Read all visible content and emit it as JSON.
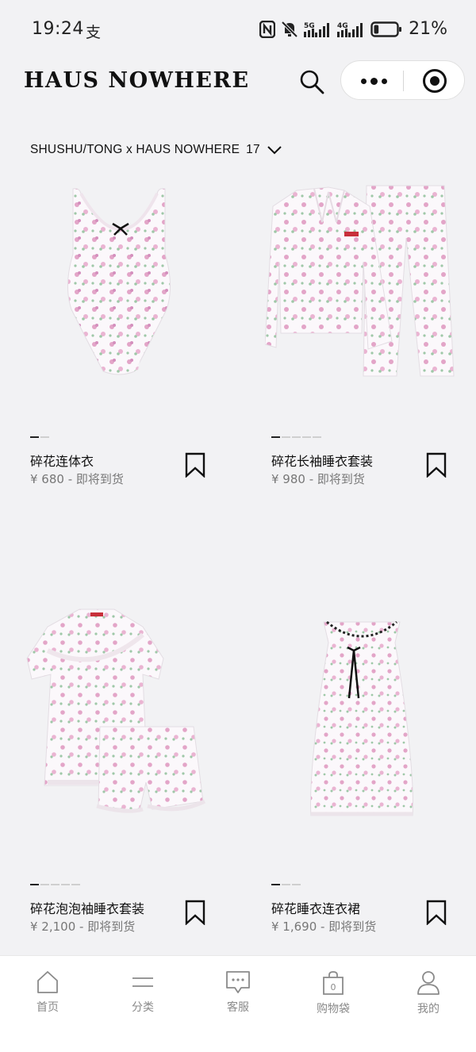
{
  "status_bar": {
    "time": "19:24",
    "app_glyph": "支",
    "icons": [
      "nfc-icon",
      "mute-icon",
      "signal-5g-icon",
      "signal-4g-icon",
      "battery-icon"
    ],
    "net1": "5G",
    "net2": "4G",
    "battery": "21%",
    "battery_level": 0.21
  },
  "header": {
    "brand": "HAUS NOWHERE",
    "search_icon": "search-icon",
    "more_icon": "more-dots-icon",
    "close_icon": "target-close-icon"
  },
  "collection": {
    "name": "SHUSHU/TONG x HAUS NOWHERE",
    "count": "17",
    "chevron_icon": "chevron-down-icon"
  },
  "products": [
    {
      "name": "碎花连体衣",
      "price": "¥ 680 - 即将到货",
      "dots": 2,
      "active_dot": 0,
      "image": "floral-bodysuit"
    },
    {
      "name": "碎花长袖睡衣套装",
      "price": "¥ 980 - 即将到货",
      "dots": 5,
      "active_dot": 0,
      "image": "floral-long-sleeve-pajama-set"
    },
    {
      "name": "碎花泡泡袖睡衣套装",
      "price": "¥ 2,100 - 即将到货",
      "dots": 5,
      "active_dot": 0,
      "image": "floral-puff-sleeve-pajama-set"
    },
    {
      "name": "碎花睡衣连衣裙",
      "price": "¥ 1,690 - 即将到货",
      "dots": 3,
      "active_dot": 0,
      "image": "floral-nightdress"
    }
  ],
  "tabbar": {
    "items": [
      {
        "label": "首页",
        "icon": "home-icon"
      },
      {
        "label": "分类",
        "icon": "menu-icon"
      },
      {
        "label": "客服",
        "icon": "chat-icon"
      },
      {
        "label": "购物袋",
        "icon": "shopping-bag-icon",
        "badge": "0"
      },
      {
        "label": "我的",
        "icon": "profile-icon"
      }
    ]
  },
  "colors": {
    "background": "#f2f2f4",
    "text": "#111111",
    "muted": "#777777",
    "floral_pink": "#e3a5c8",
    "floral_green": "#9fc8a8"
  }
}
